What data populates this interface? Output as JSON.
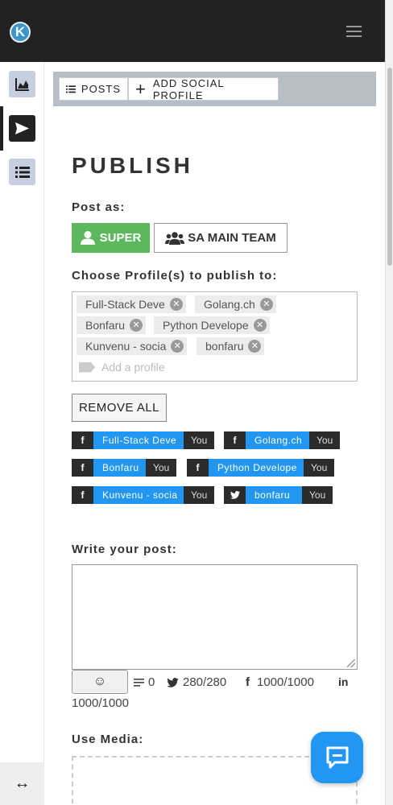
{
  "app": {
    "logo_letter": "K"
  },
  "toolbar": {
    "posts_label": "POSTS",
    "add_profile_label": "ADD SOCIAL PROFILE"
  },
  "page": {
    "title": "PUBLISH"
  },
  "post_as": {
    "label": "Post as:",
    "options": [
      {
        "label": "SUPER",
        "selected": true,
        "icon": "user-icon"
      },
      {
        "label": "SA MAIN TEAM",
        "selected": false,
        "icon": "users-icon"
      }
    ]
  },
  "profiles": {
    "label": "Choose Profile(s) to publish to:",
    "chips": [
      "Full-Stack Deve",
      "Golang.ch",
      "Bonfaru",
      "Python Develope",
      "Kunvenu - socia",
      "bonfaru"
    ],
    "add_placeholder": "Add a profile",
    "remove_all_label": "REMOVE ALL"
  },
  "selected_profiles": [
    {
      "network": "facebook",
      "name": "Full-Stack Deve",
      "owner": "You"
    },
    {
      "network": "facebook",
      "name": "Golang.ch",
      "owner": "You"
    },
    {
      "network": "facebook",
      "name": "Bonfaru",
      "owner": "You"
    },
    {
      "network": "facebook",
      "name": "Python Develope",
      "owner": "You"
    },
    {
      "network": "facebook",
      "name": "Kunvenu - socia",
      "owner": "You"
    },
    {
      "network": "twitter",
      "name": "bonfaru",
      "owner": "You"
    }
  ],
  "post": {
    "label": "Write your post:",
    "value": "",
    "char_count": "0",
    "twitter_count": "280/280",
    "facebook_count": "1000/1000",
    "linkedin_count": "1000/1000"
  },
  "media": {
    "label": "Use Media:"
  },
  "colors": {
    "accent": "#2196f3",
    "success": "#5cb85c",
    "dark": "#222222"
  }
}
